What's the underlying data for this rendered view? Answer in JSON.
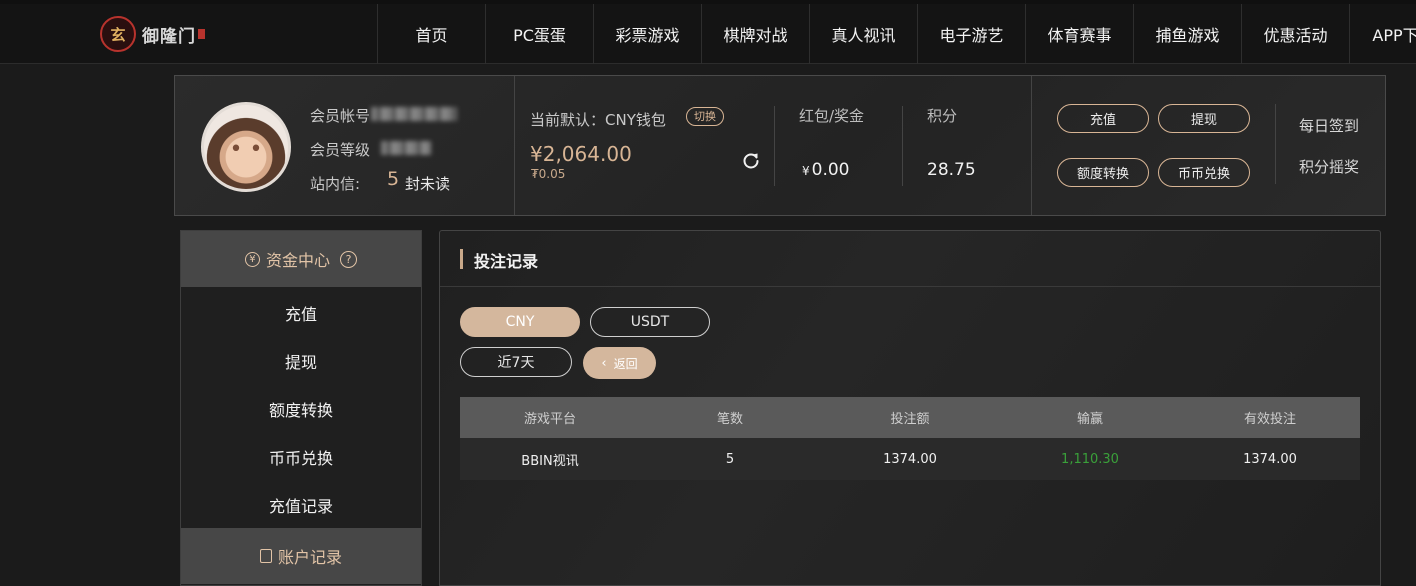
{
  "logo": {
    "mark_text": "玄",
    "name": "御隆门"
  },
  "nav": [
    "首页",
    "PC蛋蛋",
    "彩票游戏",
    "棋牌对战",
    "真人视讯",
    "电子游艺",
    "体育赛事",
    "捕鱼游戏",
    "优惠活动",
    "APP下载"
  ],
  "member": {
    "account_label": "会员帐号",
    "level_label": "会员等级",
    "message_label": "站内信:",
    "message_count": "5",
    "message_unit": "封未读"
  },
  "wallet": {
    "label": "当前默认：CNY钱包",
    "switch_label": "切换",
    "balance": "¥2,064.00",
    "sub_balance": "₮0.05"
  },
  "bonus": {
    "title": "红包/奖金",
    "currency": "¥",
    "value": "0.00"
  },
  "points": {
    "title": "积分",
    "value": "28.75"
  },
  "actions": {
    "deposit": "充值",
    "withdraw": "提现",
    "transfer": "额度转换",
    "exchange": "币币兑换"
  },
  "side_links": {
    "checkin": "每日签到",
    "lottery": "积分摇奖"
  },
  "sidebar": {
    "fund_center": "资金中心",
    "fund_icon": "¥",
    "help_icon": "?",
    "items": [
      "充值",
      "提现",
      "额度转换",
      "币币兑换",
      "充值记录"
    ],
    "account_records": "账户记录"
  },
  "main": {
    "title": "投注记录",
    "currency_tabs": [
      "CNY",
      "USDT"
    ],
    "period": "近7天",
    "back_label": "返回",
    "table": {
      "headers": [
        "游戏平台",
        "笔数",
        "投注额",
        "输赢",
        "有效投注"
      ],
      "rows": [
        [
          "BBIN视讯",
          "5",
          "1374.00",
          "1,110.30",
          "1374.00"
        ]
      ]
    }
  },
  "colors": {
    "accent": "#d4b79d",
    "win": "#3aa03a",
    "background": "#1b1b1b"
  }
}
